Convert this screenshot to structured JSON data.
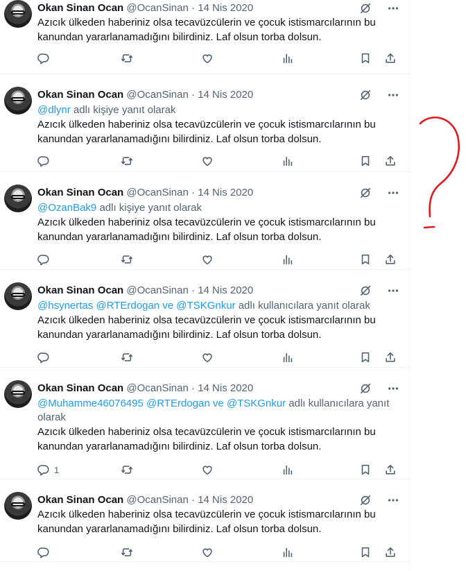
{
  "tweets": [
    {
      "name": "Okan Sinan Ocan",
      "handle": "@OcanSinan",
      "dot": "·",
      "date": "14 Nis 2020",
      "reply_to": null,
      "text": "Azıcık ülkeden haberiniz olsa tecavüzcülerin ve çocuk istismarcılarının bu kanundan yararlanamadığını bilirdiniz. Laf olsun torba dolsun.",
      "reply_count": ""
    },
    {
      "name": "Okan Sinan Ocan",
      "handle": "@OcanSinan",
      "dot": "·",
      "date": "14 Nis 2020",
      "reply_to": {
        "mentions": [
          "@dlynr"
        ],
        "suffix": " adlı kişiye yanıt olarak"
      },
      "text": "Azıcık ülkeden haberiniz olsa tecavüzcülerin ve çocuk istismarcılarının bu kanundan yararlanamadığını bilirdiniz. Laf olsun torba dolsun.",
      "reply_count": ""
    },
    {
      "name": "Okan Sinan Ocan",
      "handle": "@OcanSinan",
      "dot": "·",
      "date": "14 Nis 2020",
      "reply_to": {
        "mentions": [
          "@OzanBak9"
        ],
        "suffix": " adlı kişiye yanıt olarak"
      },
      "text": "Azıcık ülkeden haberiniz olsa tecavüzcülerin ve çocuk istismarcılarının bu kanundan yararlanamadığını bilirdiniz. Laf olsun torba dolsun.",
      "reply_count": ""
    },
    {
      "name": "Okan Sinan Ocan",
      "handle": "@OcanSinan",
      "dot": "·",
      "date": "14 Nis 2020",
      "reply_to": {
        "mentions": [
          "@hsynertas",
          "@RTErdogan",
          "@TSKGnkur"
        ],
        "suffix": " adlı kullanıcılara yanıt olarak"
      },
      "text": "Azıcık ülkeden haberiniz olsa tecavüzcülerin ve çocuk istismarcılarının bu kanundan yararlanamadığını bilirdiniz. Laf olsun torba dolsun.",
      "reply_count": ""
    },
    {
      "name": "Okan Sinan Ocan",
      "handle": "@OcanSinan",
      "dot": "·",
      "date": "14 Nis 2020",
      "reply_to": {
        "mentions": [
          "@Muhamme46076495",
          "@RTErdogan",
          "@TSKGnkur"
        ],
        "suffix": " adlı kullanıcılara yanıt olarak"
      },
      "text": "Azıcık ülkeden haberiniz olsa tecavüzcülerin ve çocuk istismarcılarının bu kanundan yararlanamadığını bilirdiniz. Laf olsun torba dolsun.",
      "reply_count": "1"
    },
    {
      "name": "Okan Sinan Ocan",
      "handle": "@OcanSinan",
      "dot": "·",
      "date": "14 Nis 2020",
      "reply_to": null,
      "text": "Azıcık ülkeden haberiniz olsa tecavüzcülerin ve çocuk istismarcılarının bu kanundan yararlanamadığını bilirdiniz. Laf olsun torba dolsun.",
      "reply_count": ""
    }
  ],
  "conjunction": " ve ",
  "icons": {
    "top": [
      "grok-icon",
      "more-icon"
    ],
    "actions": [
      "reply-icon",
      "retweet-icon",
      "like-icon",
      "views-icon",
      "bookmark-icon",
      "share-icon"
    ]
  },
  "colors": {
    "mention": "#1d9bf0",
    "secondary": "#536471",
    "annotation": "#e0191d"
  },
  "annotation_mark": "question-mark-drawing"
}
